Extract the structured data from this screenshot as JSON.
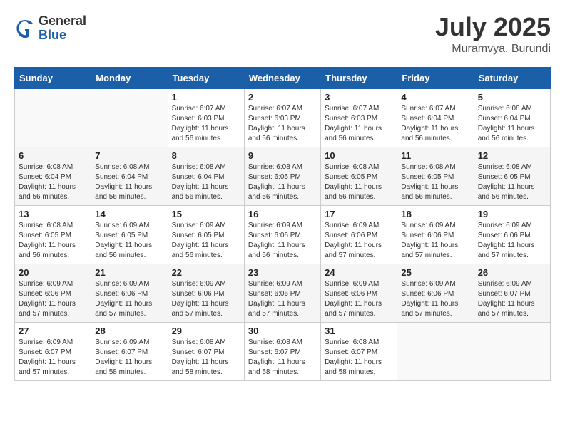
{
  "header": {
    "logo_general": "General",
    "logo_blue": "Blue",
    "month_year": "July 2025",
    "location": "Muramvya, Burundi"
  },
  "days_of_week": [
    "Sunday",
    "Monday",
    "Tuesday",
    "Wednesday",
    "Thursday",
    "Friday",
    "Saturday"
  ],
  "weeks": [
    [
      {
        "day": "",
        "info": ""
      },
      {
        "day": "",
        "info": ""
      },
      {
        "day": "1",
        "info": "Sunrise: 6:07 AM\nSunset: 6:03 PM\nDaylight: 11 hours and 56 minutes."
      },
      {
        "day": "2",
        "info": "Sunrise: 6:07 AM\nSunset: 6:03 PM\nDaylight: 11 hours and 56 minutes."
      },
      {
        "day": "3",
        "info": "Sunrise: 6:07 AM\nSunset: 6:03 PM\nDaylight: 11 hours and 56 minutes."
      },
      {
        "day": "4",
        "info": "Sunrise: 6:07 AM\nSunset: 6:04 PM\nDaylight: 11 hours and 56 minutes."
      },
      {
        "day": "5",
        "info": "Sunrise: 6:08 AM\nSunset: 6:04 PM\nDaylight: 11 hours and 56 minutes."
      }
    ],
    [
      {
        "day": "6",
        "info": "Sunrise: 6:08 AM\nSunset: 6:04 PM\nDaylight: 11 hours and 56 minutes."
      },
      {
        "day": "7",
        "info": "Sunrise: 6:08 AM\nSunset: 6:04 PM\nDaylight: 11 hours and 56 minutes."
      },
      {
        "day": "8",
        "info": "Sunrise: 6:08 AM\nSunset: 6:04 PM\nDaylight: 11 hours and 56 minutes."
      },
      {
        "day": "9",
        "info": "Sunrise: 6:08 AM\nSunset: 6:05 PM\nDaylight: 11 hours and 56 minutes."
      },
      {
        "day": "10",
        "info": "Sunrise: 6:08 AM\nSunset: 6:05 PM\nDaylight: 11 hours and 56 minutes."
      },
      {
        "day": "11",
        "info": "Sunrise: 6:08 AM\nSunset: 6:05 PM\nDaylight: 11 hours and 56 minutes."
      },
      {
        "day": "12",
        "info": "Sunrise: 6:08 AM\nSunset: 6:05 PM\nDaylight: 11 hours and 56 minutes."
      }
    ],
    [
      {
        "day": "13",
        "info": "Sunrise: 6:08 AM\nSunset: 6:05 PM\nDaylight: 11 hours and 56 minutes."
      },
      {
        "day": "14",
        "info": "Sunrise: 6:09 AM\nSunset: 6:05 PM\nDaylight: 11 hours and 56 minutes."
      },
      {
        "day": "15",
        "info": "Sunrise: 6:09 AM\nSunset: 6:05 PM\nDaylight: 11 hours and 56 minutes."
      },
      {
        "day": "16",
        "info": "Sunrise: 6:09 AM\nSunset: 6:06 PM\nDaylight: 11 hours and 56 minutes."
      },
      {
        "day": "17",
        "info": "Sunrise: 6:09 AM\nSunset: 6:06 PM\nDaylight: 11 hours and 57 minutes."
      },
      {
        "day": "18",
        "info": "Sunrise: 6:09 AM\nSunset: 6:06 PM\nDaylight: 11 hours and 57 minutes."
      },
      {
        "day": "19",
        "info": "Sunrise: 6:09 AM\nSunset: 6:06 PM\nDaylight: 11 hours and 57 minutes."
      }
    ],
    [
      {
        "day": "20",
        "info": "Sunrise: 6:09 AM\nSunset: 6:06 PM\nDaylight: 11 hours and 57 minutes."
      },
      {
        "day": "21",
        "info": "Sunrise: 6:09 AM\nSunset: 6:06 PM\nDaylight: 11 hours and 57 minutes."
      },
      {
        "day": "22",
        "info": "Sunrise: 6:09 AM\nSunset: 6:06 PM\nDaylight: 11 hours and 57 minutes."
      },
      {
        "day": "23",
        "info": "Sunrise: 6:09 AM\nSunset: 6:06 PM\nDaylight: 11 hours and 57 minutes."
      },
      {
        "day": "24",
        "info": "Sunrise: 6:09 AM\nSunset: 6:06 PM\nDaylight: 11 hours and 57 minutes."
      },
      {
        "day": "25",
        "info": "Sunrise: 6:09 AM\nSunset: 6:06 PM\nDaylight: 11 hours and 57 minutes."
      },
      {
        "day": "26",
        "info": "Sunrise: 6:09 AM\nSunset: 6:07 PM\nDaylight: 11 hours and 57 minutes."
      }
    ],
    [
      {
        "day": "27",
        "info": "Sunrise: 6:09 AM\nSunset: 6:07 PM\nDaylight: 11 hours and 57 minutes."
      },
      {
        "day": "28",
        "info": "Sunrise: 6:09 AM\nSunset: 6:07 PM\nDaylight: 11 hours and 58 minutes."
      },
      {
        "day": "29",
        "info": "Sunrise: 6:08 AM\nSunset: 6:07 PM\nDaylight: 11 hours and 58 minutes."
      },
      {
        "day": "30",
        "info": "Sunrise: 6:08 AM\nSunset: 6:07 PM\nDaylight: 11 hours and 58 minutes."
      },
      {
        "day": "31",
        "info": "Sunrise: 6:08 AM\nSunset: 6:07 PM\nDaylight: 11 hours and 58 minutes."
      },
      {
        "day": "",
        "info": ""
      },
      {
        "day": "",
        "info": ""
      }
    ]
  ]
}
